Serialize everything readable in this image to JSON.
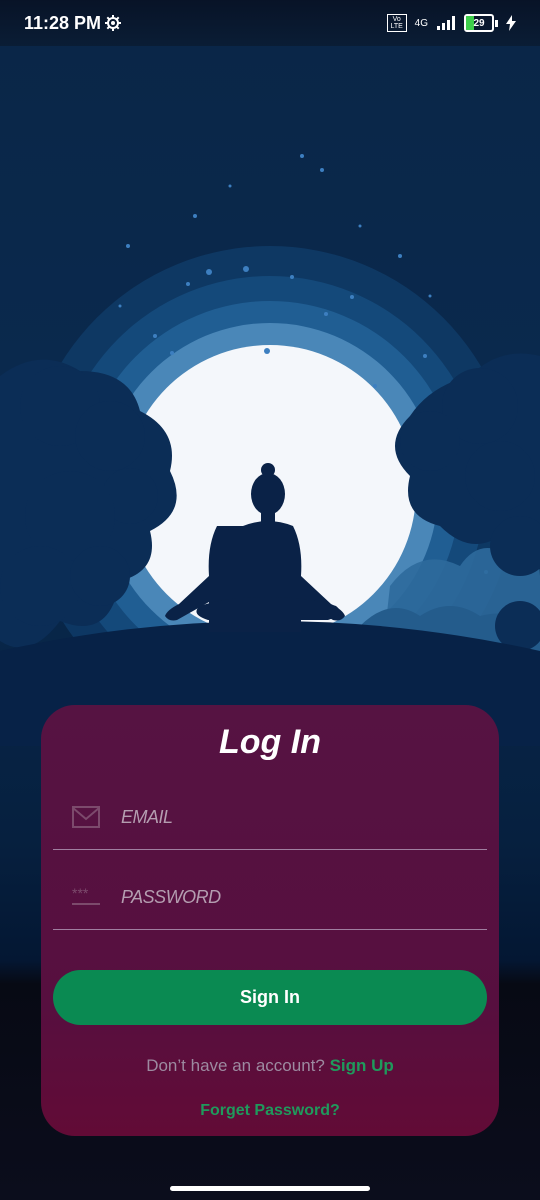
{
  "status_bar": {
    "time": "11:28 PM",
    "network": "4G",
    "volte": "Vo LTE",
    "battery": "29"
  },
  "login": {
    "title": "Log In",
    "email_placeholder": "EMAIL",
    "email_icon": "mail-icon",
    "password_placeholder": "PASSWORD",
    "password_icon": "password-dots-icon",
    "signin_label": "Sign In",
    "no_account_text": "Don’t have an account?",
    "signup_label": "Sign Up",
    "forgot_label": "Forget Password?"
  },
  "colors": {
    "background": "#0a2647",
    "card": "#561342",
    "accent_green": "#0a8a52",
    "link_green": "#1f9a5c"
  }
}
